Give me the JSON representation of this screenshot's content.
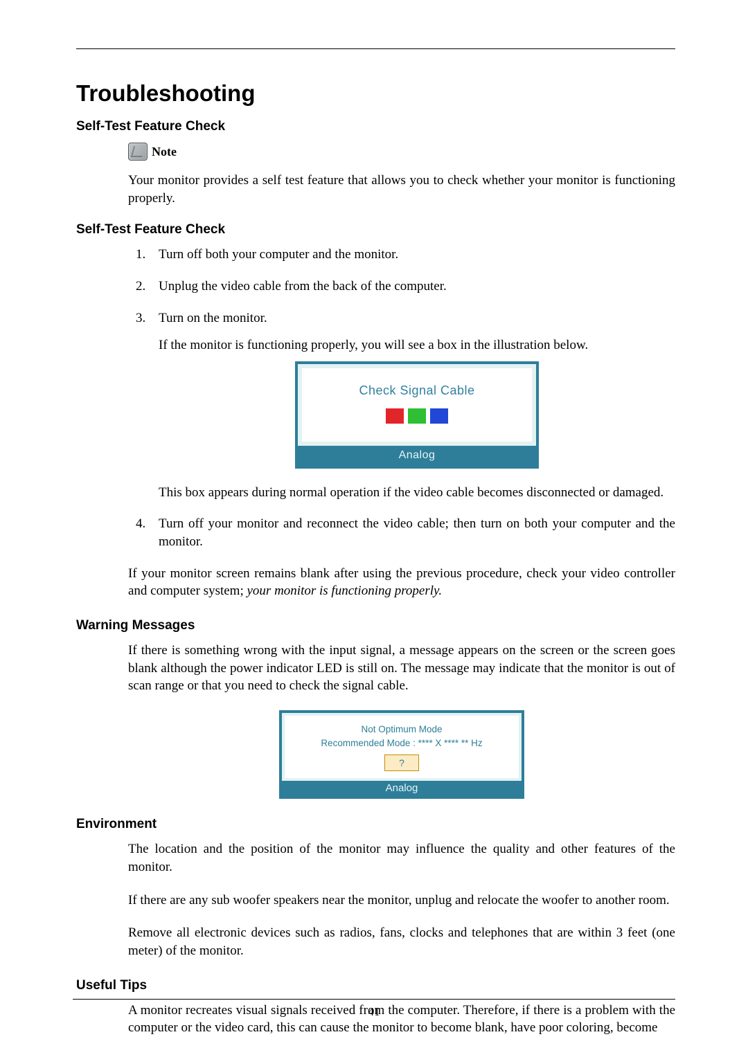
{
  "page_number": "41",
  "title": "Troubleshooting",
  "sections": {
    "selftest1": {
      "heading": "Self-Test Feature Check",
      "note_label": "Note",
      "intro": "Your monitor provides a self test feature that allows you to check whether your monitor is functioning properly."
    },
    "selftest2": {
      "heading": "Self-Test Feature Check",
      "step1": "Turn off both your computer and the monitor.",
      "step2": "Unplug the video cable from the back of the computer.",
      "step3": "Turn on the monitor.",
      "step3_after": "If the monitor is functioning properly, you will see a box in the illustration below.",
      "box_title": "Check Signal Cable",
      "box_foot": "Analog",
      "step3_after2": "This box appears during normal operation if the video cable becomes disconnected or damaged.",
      "step4": "Turn off your monitor and reconnect the video cable; then turn on both your computer and the monitor.",
      "conclusion_pre": "If your monitor screen remains blank after using the previous procedure, check your video controller and computer system; ",
      "conclusion_italic": "your monitor is functioning properly."
    },
    "warning": {
      "heading": "Warning Messages",
      "body": "If there is something wrong with the input signal, a message appears on the screen or the screen goes blank although the power indicator LED is still on. The message may indicate that the monitor is out of scan range or that you need to check the signal cable.",
      "box_line1": "Not Optimum Mode",
      "box_line2": "Recommended Mode : **** X **** ** Hz",
      "box_q": "?",
      "box_foot": "Analog"
    },
    "environment": {
      "heading": "Environment",
      "p1": "The location and the position of the monitor may influence the quality and other features of the monitor.",
      "p2": "If there are any sub woofer speakers near the monitor, unplug and relocate the woofer to another room.",
      "p3": "Remove all electronic devices such as radios, fans, clocks and telephones that are within 3 feet (one meter) of the monitor."
    },
    "tips": {
      "heading": "Useful Tips",
      "p1": "A monitor recreates visual signals received from the computer. Therefore, if there is a problem with the computer or the video card, this can cause the monitor to become blank, have poor coloring, become"
    }
  }
}
